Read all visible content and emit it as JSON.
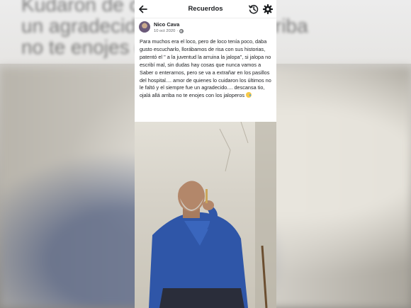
{
  "backdrop": {
    "line1": "Kudaron de c                   e sampre fue",
    "line2": "un agradecid           tio, ojalá allá arriba",
    "line3": "no te enojes c"
  },
  "topbar": {
    "title": "Recuerdos",
    "back_icon": "arrow-left-icon",
    "history_icon": "history-icon",
    "settings_icon": "gear-icon"
  },
  "post": {
    "author": "Nico Cava",
    "date": "10 oct 2020",
    "separator": "·",
    "privacy_icon": "globe-icon",
    "text": "Para muchos era el loco, pero de loco tenía poco, daba gusto escucharlo, llorábamos de risa con sus historias, patentó el \" a la juventud la arruina la jalopa\", si jalopa no escribí mal, sin dudas hay cosas que nunca vamos a Saber o enterarnos, pero se va a extrañar en los pasillos del hospital.... amor de quienes lo cuidaron los últimos no le faltó y el siempre fue un agradecido.... descansa tio, ojalá allá arriba no te enojes con los jaloperos",
    "emoji": "crying-face-emoji"
  },
  "colors": {
    "text": "#1c1e21",
    "meta": "#65676b",
    "background": "#ffffff",
    "shirt": "#2f56a8"
  }
}
